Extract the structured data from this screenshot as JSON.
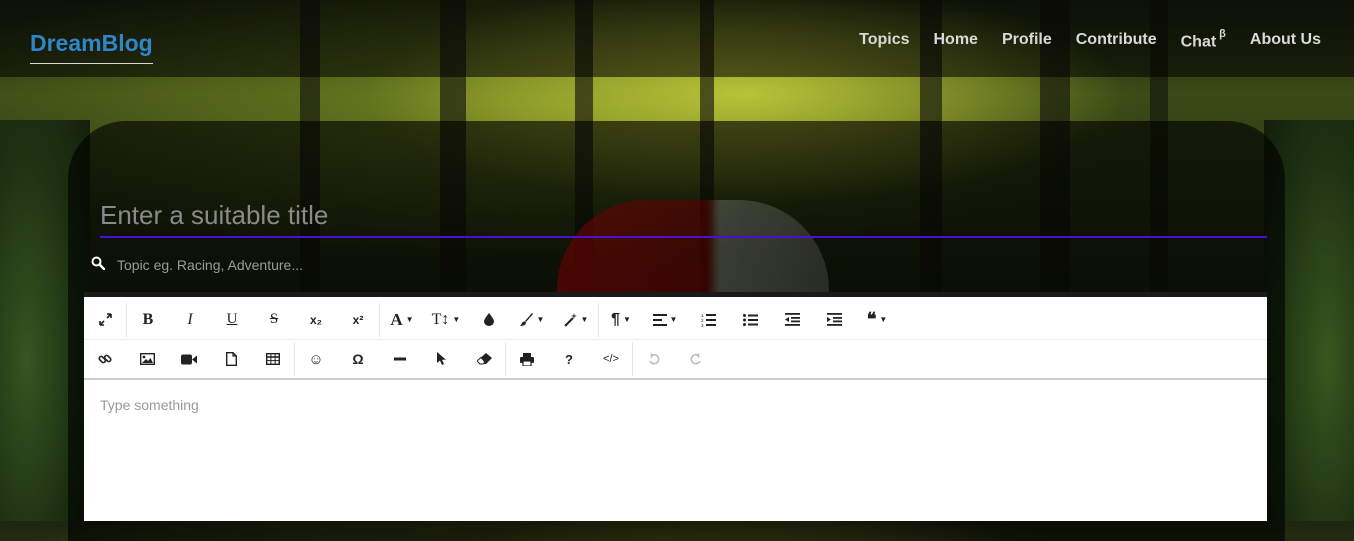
{
  "brand": "DreamBlog",
  "nav": {
    "topics": "Topics",
    "home": "Home",
    "profile": "Profile",
    "contribute": "Contribute",
    "chat": "Chat",
    "chat_badge": "β",
    "about": "About Us"
  },
  "form": {
    "title_placeholder": "Enter a suitable title",
    "topic_placeholder": "Topic eg. Racing, Adventure..."
  },
  "editor": {
    "placeholder": "Type something",
    "toolbar": {
      "bold": "B",
      "italic": "I",
      "underline": "U",
      "strikethrough": "S",
      "subscript": "x₂",
      "superscript": "x²",
      "font_family": "A",
      "font_size": "T↕",
      "special_chars": "Ω",
      "help": "?",
      "code_view": "</>"
    }
  },
  "colors": {
    "brand": "#2e86c9",
    "title_underline": "#4a0fd6",
    "nav_text": "#d9d9d9"
  }
}
